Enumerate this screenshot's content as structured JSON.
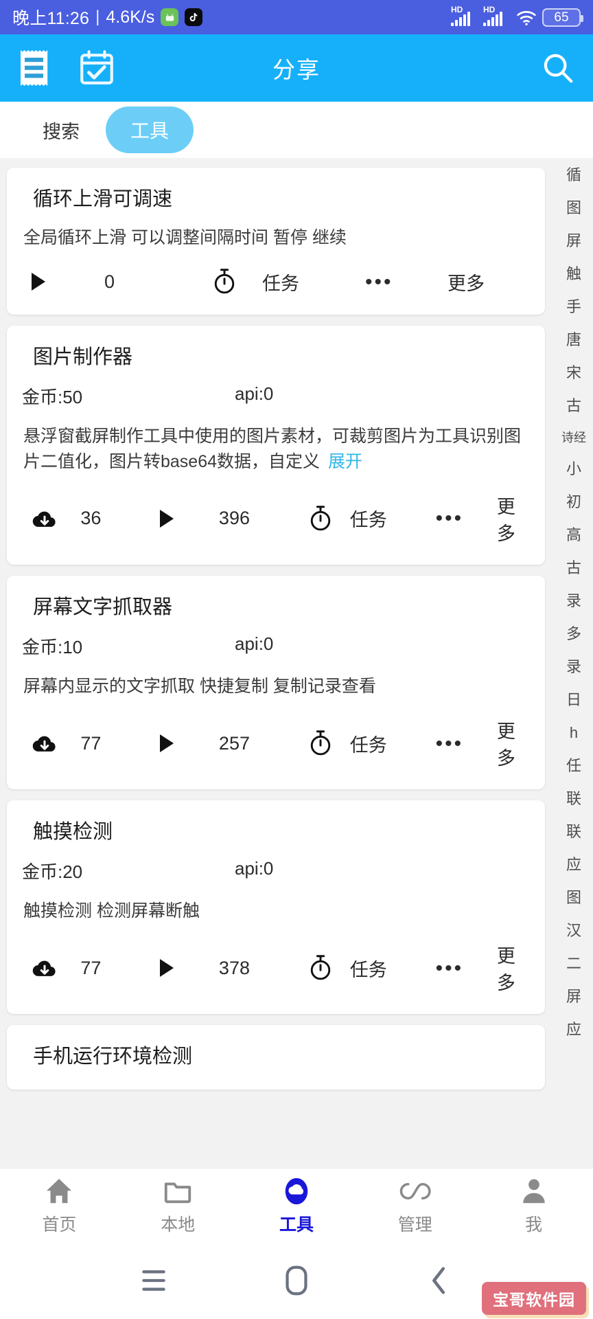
{
  "statusbar": {
    "time": "晚上11:26",
    "separator": "|",
    "speed": "4.6K/s",
    "app_badges": [
      "android-icon",
      "tiktok-icon"
    ],
    "hd_label": "HD",
    "battery": "65",
    "accent": "#4a5ee0"
  },
  "appbar": {
    "title": "分享",
    "left_icons": [
      "receipt-icon",
      "calendar-check-icon"
    ],
    "right_icon": "search-icon",
    "bg": "#16b0fa"
  },
  "tabs": [
    {
      "label": "搜索",
      "active": false
    },
    {
      "label": "工具",
      "active": true
    }
  ],
  "cards": [
    {
      "title": "循环上滑可调速",
      "has_meta": false,
      "coin": "",
      "api": "",
      "desc": "全局循环上滑 可以调整间隔时间 暂停 继续",
      "expand_label": "",
      "has_download": false,
      "download_count": "",
      "play_count": "0",
      "task_label": "任务",
      "more_label": "更多"
    },
    {
      "title": "图片制作器",
      "has_meta": true,
      "coin": "金币:50",
      "api": "api:0",
      "desc": "悬浮窗截屏制作工具中使用的图片素材，可裁剪图片为工具识别图片二值化，图片转base64数据，自定义",
      "expand_label": "展开",
      "has_download": true,
      "download_count": "36",
      "play_count": "396",
      "task_label": "任务",
      "more_label": "更多"
    },
    {
      "title": "屏幕文字抓取器",
      "has_meta": true,
      "coin": "金币:10",
      "api": "api:0",
      "desc": "屏幕内显示的文字抓取 快捷复制 复制记录查看",
      "expand_label": "",
      "has_download": true,
      "download_count": "77",
      "play_count": "257",
      "task_label": "任务",
      "more_label": "更多"
    },
    {
      "title": "触摸检测",
      "has_meta": true,
      "coin": "金币:20",
      "api": "api:0",
      "desc": "触摸检测 检测屏幕断触",
      "expand_label": "",
      "has_download": true,
      "download_count": "77",
      "play_count": "378",
      "task_label": "任务",
      "more_label": "更多"
    },
    {
      "title": "手机运行环境检测",
      "has_meta": false,
      "coin": "",
      "api": "",
      "desc": "",
      "expand_label": "",
      "has_download": false,
      "download_count": "",
      "play_count": "",
      "task_label": "",
      "more_label": ""
    }
  ],
  "side_index": [
    "循",
    "图",
    "屏",
    "触",
    "手",
    "唐",
    "宋",
    "古",
    "诗经",
    "小",
    "初",
    "高",
    "古",
    "录",
    "多",
    "录",
    "日",
    "h",
    "任",
    "联",
    "联",
    "应",
    "图",
    "汉",
    "二",
    "屏",
    "应"
  ],
  "bottomnav": [
    {
      "label": "首页",
      "icon": "home-icon",
      "active": false
    },
    {
      "label": "本地",
      "icon": "folder-icon",
      "active": false
    },
    {
      "label": "工具",
      "icon": "cloud-icon",
      "active": true
    },
    {
      "label": "管理",
      "icon": "infinity-icon",
      "active": false
    },
    {
      "label": "我",
      "icon": "person-icon",
      "active": false
    }
  ],
  "sysnav": {
    "menu": "menu-icon",
    "home": "home-square-icon",
    "back": "back-chevron-icon"
  },
  "watermark": {
    "text": "宝哥软件园",
    "bg": "#e0707c"
  }
}
